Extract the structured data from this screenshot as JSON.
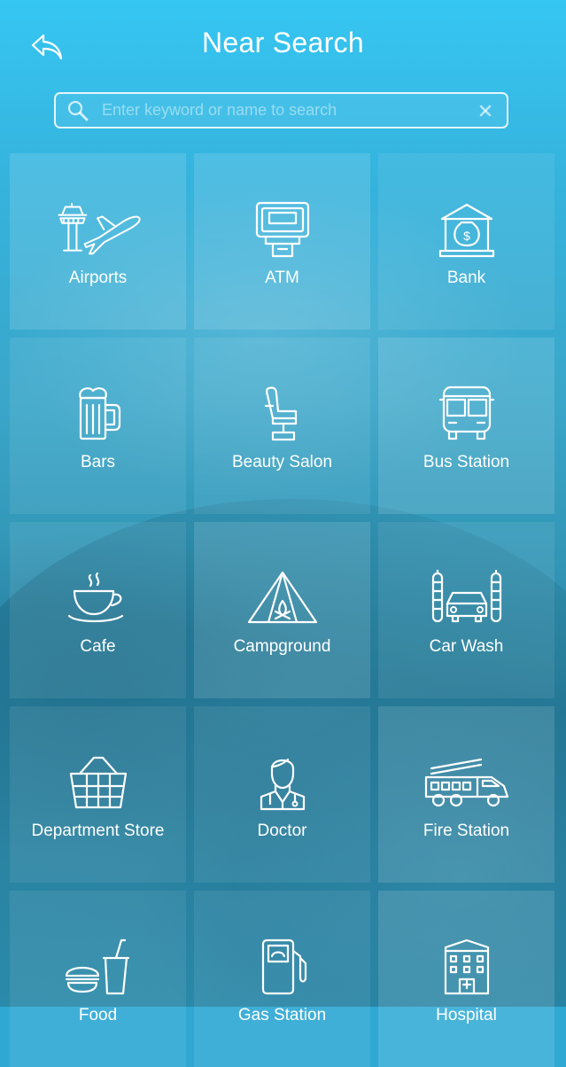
{
  "header": {
    "title": "Near Search",
    "back_icon": "reply-arrow-icon"
  },
  "search": {
    "placeholder": "Enter keyword or name to search",
    "value": "",
    "search_icon": "magnifier-icon",
    "clear_icon": "close-icon"
  },
  "categories": [
    {
      "label": "Airports",
      "icon": "airport-icon"
    },
    {
      "label": "ATM",
      "icon": "atm-icon"
    },
    {
      "label": "Bank",
      "icon": "bank-icon"
    },
    {
      "label": "Bars",
      "icon": "beer-mug-icon"
    },
    {
      "label": "Beauty Salon",
      "icon": "salon-chair-icon"
    },
    {
      "label": "Bus Station",
      "icon": "bus-icon"
    },
    {
      "label": "Cafe",
      "icon": "coffee-cup-icon"
    },
    {
      "label": "Campground",
      "icon": "tent-icon"
    },
    {
      "label": "Car Wash",
      "icon": "car-wash-icon"
    },
    {
      "label": "Department Store",
      "icon": "shopping-basket-icon"
    },
    {
      "label": "Doctor",
      "icon": "doctor-icon"
    },
    {
      "label": "Fire Station",
      "icon": "fire-truck-icon"
    },
    {
      "label": "Food",
      "icon": "fast-food-icon"
    },
    {
      "label": "Gas Station",
      "icon": "fuel-pump-icon"
    },
    {
      "label": "Hospital",
      "icon": "hospital-icon"
    }
  ],
  "colors": {
    "background_top": "#36c6f2",
    "background_bottom": "#2a8cad",
    "text": "#ffffff"
  }
}
